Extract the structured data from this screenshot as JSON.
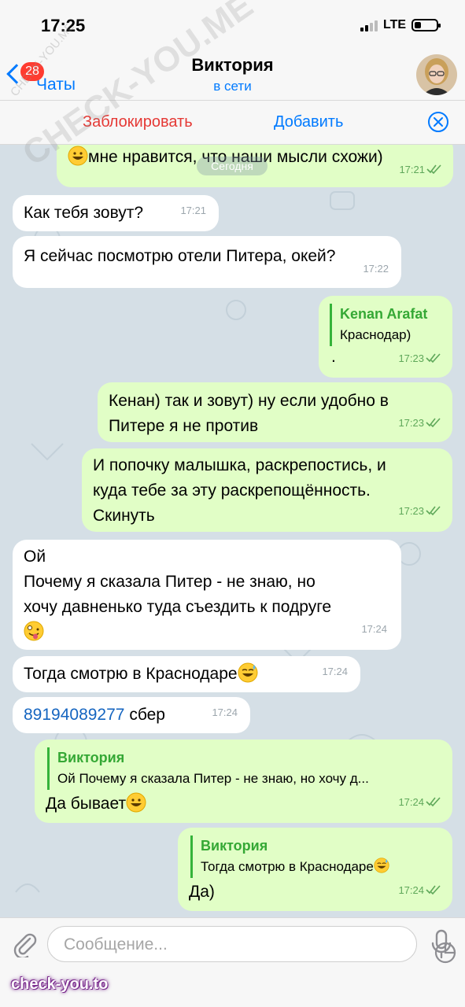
{
  "status_bar": {
    "time": "17:25",
    "network": "LTE",
    "battery_level": 0.3
  },
  "header": {
    "back_badge": "28",
    "back_label": "Чаты",
    "contact_name": "Виктория",
    "contact_status": "в сети"
  },
  "actions": {
    "block_label": "Заблокировать",
    "add_label": "Добавить"
  },
  "chat": {
    "date_pill": "Сегодня",
    "messages": [
      {
        "dir": "out",
        "text": "мне нравится, что наши мысли схожи)",
        "time": "17:21",
        "emoji": "grin"
      },
      {
        "dir": "in",
        "text": "Как тебя зовут?",
        "time": "17:21"
      },
      {
        "dir": "in",
        "text": "Я сейчас посмотрю отели Питера, окей?",
        "time": "17:22"
      },
      {
        "dir": "out",
        "reply_name": "Kenan Arafat",
        "reply_text": "Краснодар)",
        "text": ".",
        "time": "17:23"
      },
      {
        "dir": "out",
        "line1": "Кенан) так и зовут) ну если удобно в",
        "line2": "Питере я не против",
        "time": "17:23"
      },
      {
        "dir": "out",
        "line1": "И попочку малышка, раскрепостись, и",
        "line2": "куда тебе за эту раскрепощённость.",
        "line3": "Скинуть",
        "time": "17:23"
      },
      {
        "dir": "in",
        "line1": "Ой",
        "line2": "Почему я сказала Питер - не знаю, но",
        "line3": "хочу давненько туда съездить к подруге",
        "time": "17:24",
        "emoji": "zany"
      },
      {
        "dir": "in",
        "text": "Тогда смотрю в Краснодаре",
        "time": "17:24",
        "emoji": "sweat-smile"
      },
      {
        "dir": "in",
        "phone": "89194089277",
        "text": " сбер",
        "time": "17:24"
      },
      {
        "dir": "out",
        "reply_name": "Виктория",
        "reply_text": "Ой Почему я сказала Питер - не знаю, но хочу д...",
        "text": "Да бывает",
        "time": "17:24",
        "emoji": "grin"
      },
      {
        "dir": "out",
        "reply_name": "Виктория",
        "reply_text": "Тогда смотрю в Краснодаре",
        "text": "Да)",
        "time": "17:24",
        "emoji": "sweat-smile"
      }
    ]
  },
  "composer": {
    "placeholder": "Сообщение..."
  },
  "watermarks": {
    "site": "check-you.to",
    "diagonal": "CHECK-YOU.ME",
    "small": "CHECK-YOU.ME"
  },
  "colors": {
    "accent": "#007aff",
    "outgoing": "#e1fec6",
    "incoming": "#ffffff",
    "danger": "#e53935",
    "reply_bar": "#35b33a"
  }
}
